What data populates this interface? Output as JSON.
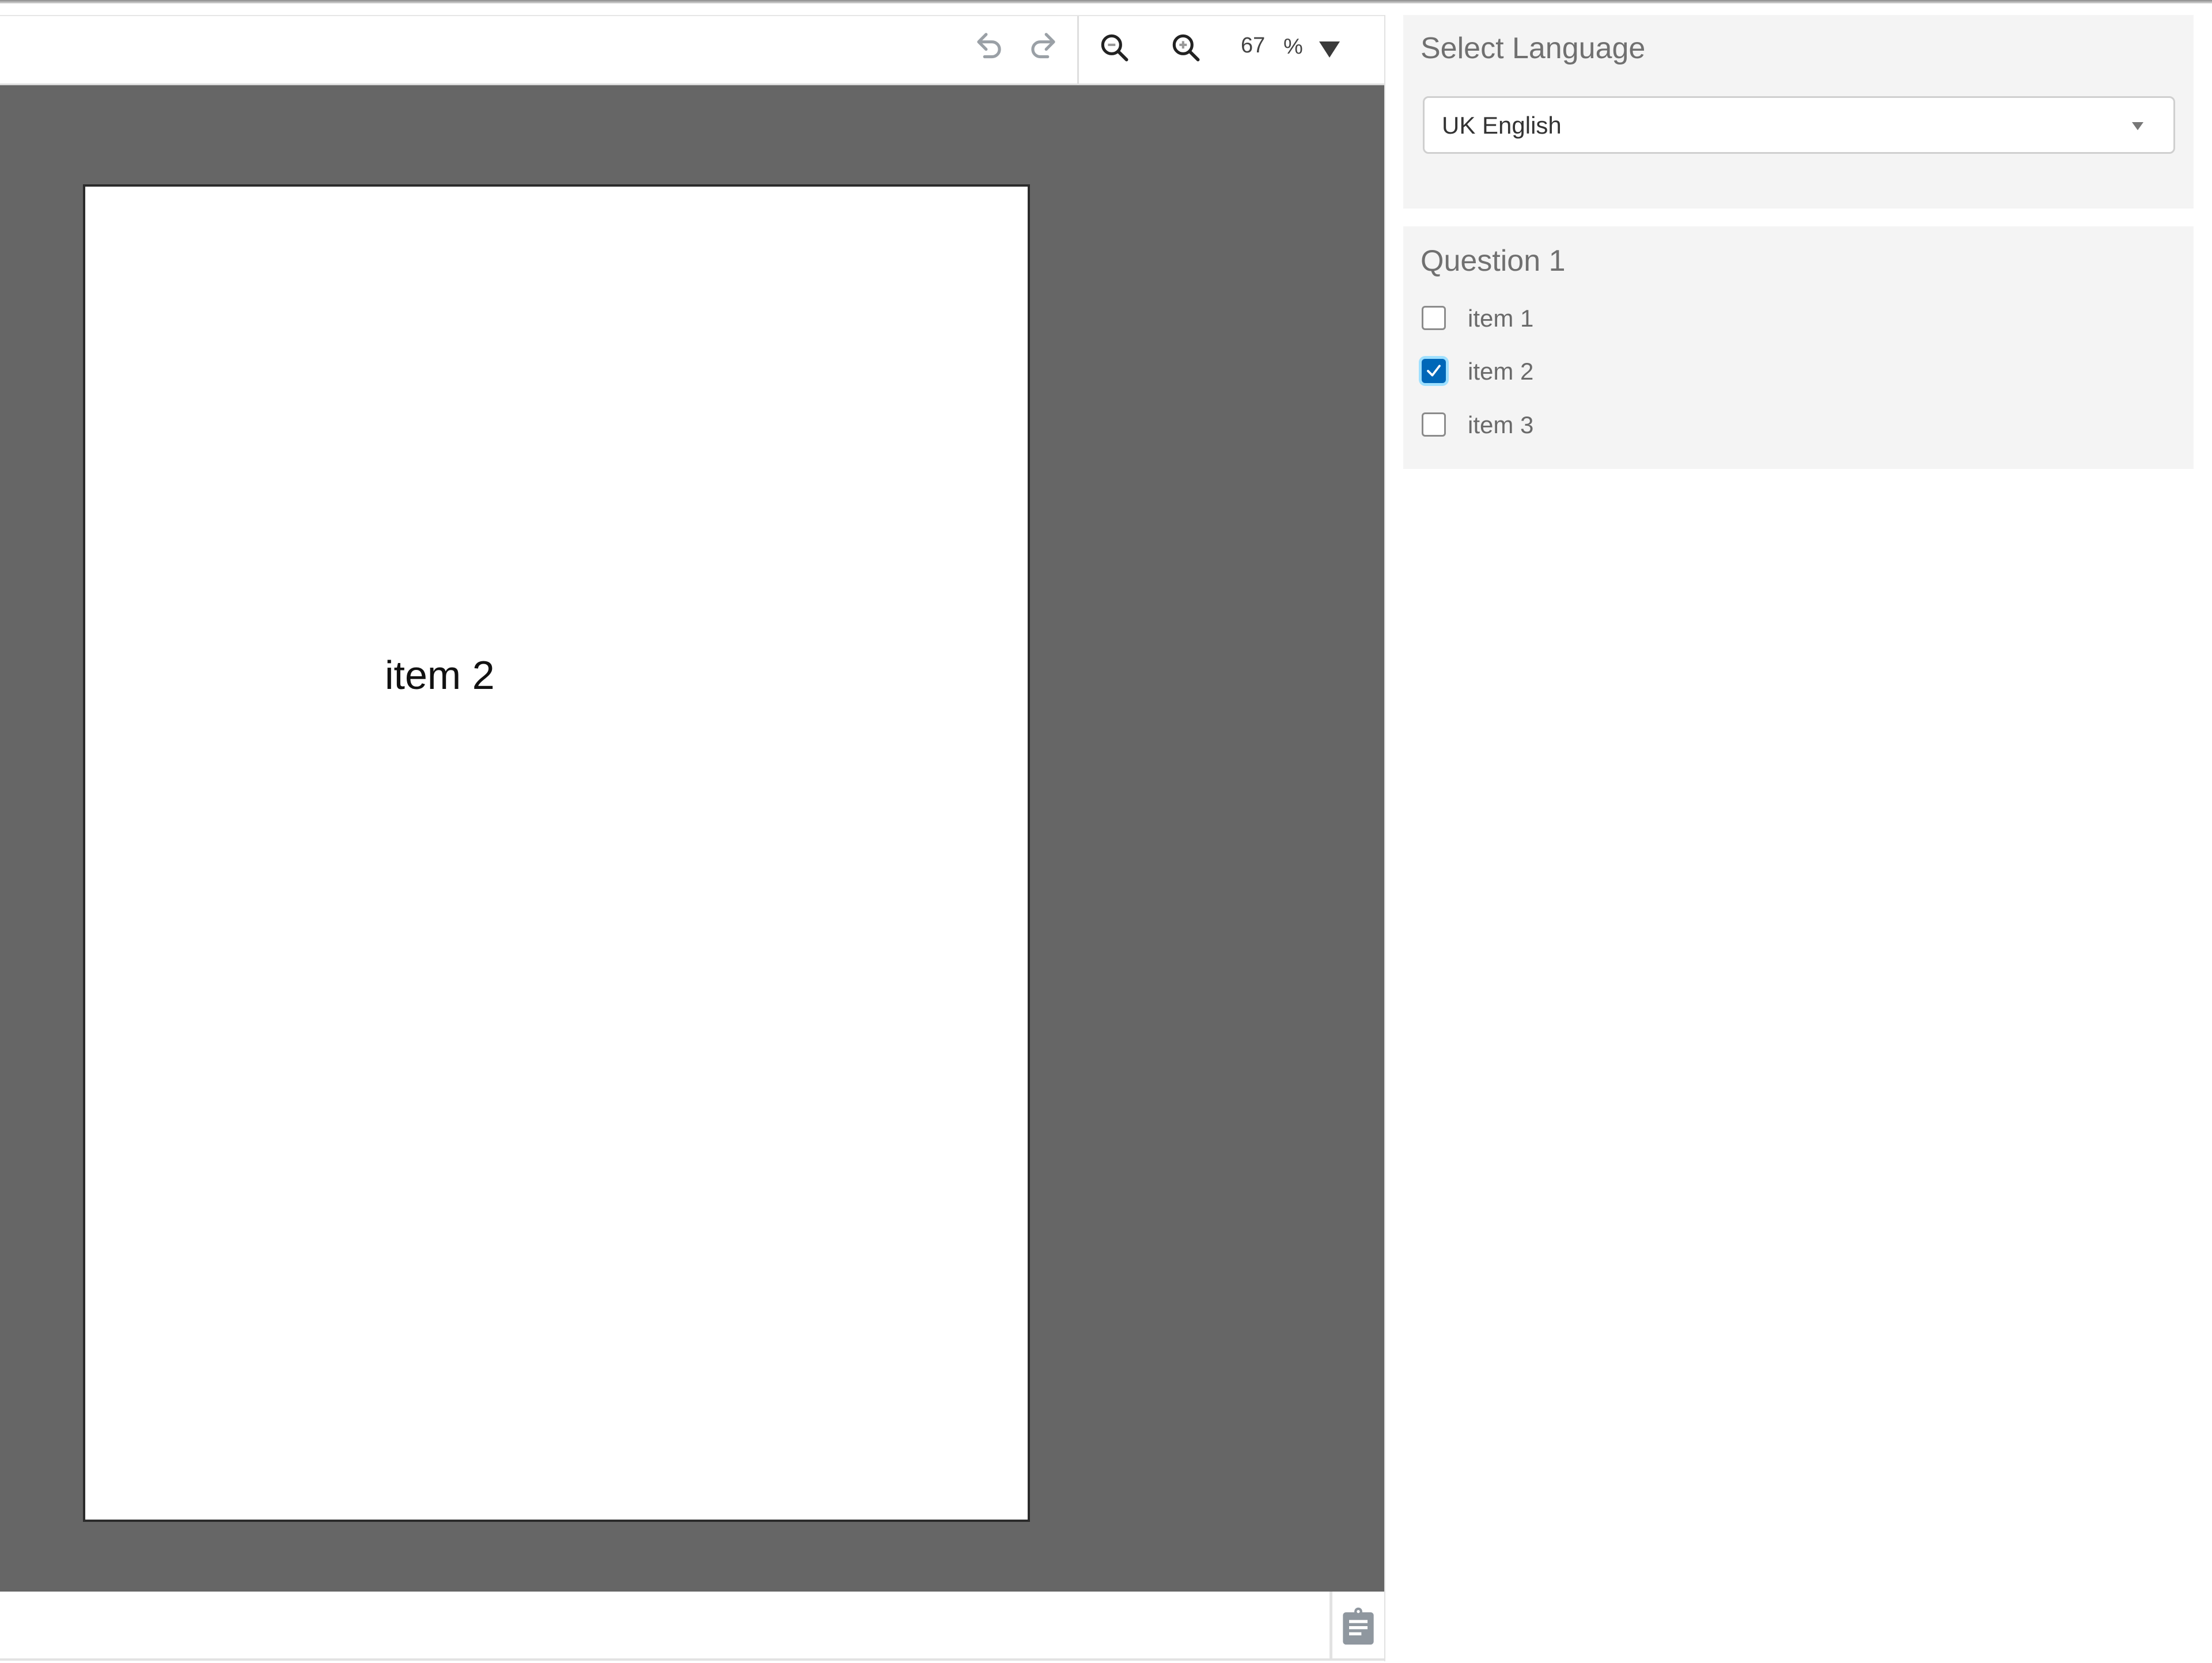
{
  "toolbar": {
    "undo_icon": "undo-icon",
    "redo_icon": "redo-icon",
    "zoom_out_icon": "zoom-out-icon",
    "zoom_in_icon": "zoom-in-icon",
    "zoom_value": "67",
    "zoom_unit": "%",
    "zoom_dropdown_icon": "caret-down-icon"
  },
  "document": {
    "page_text": "item 2"
  },
  "bottombar": {
    "clipboard_icon": "clipboard-icon"
  },
  "language_panel": {
    "title": "Select Language",
    "selected": "UK English"
  },
  "question_panel": {
    "title": "Question 1",
    "items": [
      {
        "label": "item 1",
        "checked": false
      },
      {
        "label": "item 2",
        "checked": true
      },
      {
        "label": "item 3",
        "checked": false
      }
    ]
  },
  "colors": {
    "canvas": "#666666",
    "panel": "#f4f4f4",
    "checkbox_checked": "#0067b8",
    "focus_ring": "#9fe0ff"
  }
}
